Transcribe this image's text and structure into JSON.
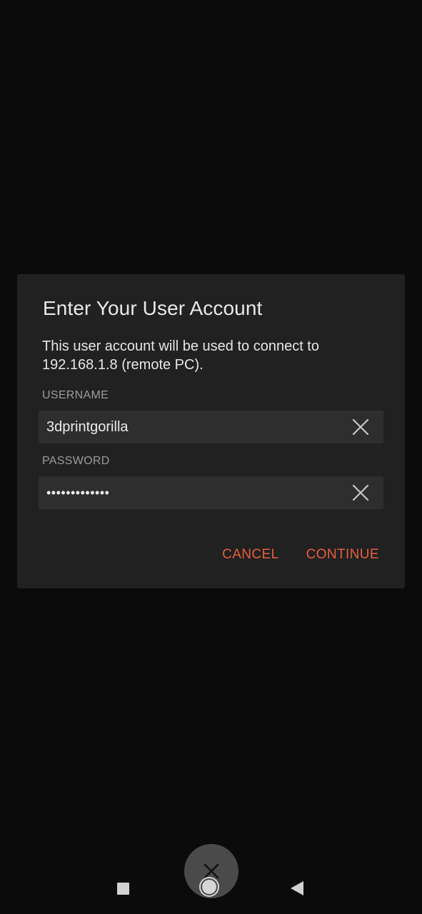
{
  "dialog": {
    "title": "Enter Your User Account",
    "message": "This user account will be used to connect to 192.168.1.8 (remote PC).",
    "username": {
      "label": "USERNAME",
      "value": "3dprintgorilla",
      "clear_icon": "close-icon"
    },
    "password": {
      "label": "PASSWORD",
      "value": "•••••••••••••",
      "clear_icon": "close-icon"
    },
    "actions": {
      "cancel": "CANCEL",
      "continue": "CONTINUE"
    }
  },
  "nav_bar": {
    "recents_icon": "square-icon",
    "home_icon": "circle-icon",
    "back_icon": "triangle-back-icon",
    "floating_button_icon": "close-icon"
  },
  "colors": {
    "background": "#0b0b0b",
    "dialog": "#212121",
    "field": "#2e2e2e",
    "accent": "#e85d3f",
    "label": "#9c9c9c"
  }
}
